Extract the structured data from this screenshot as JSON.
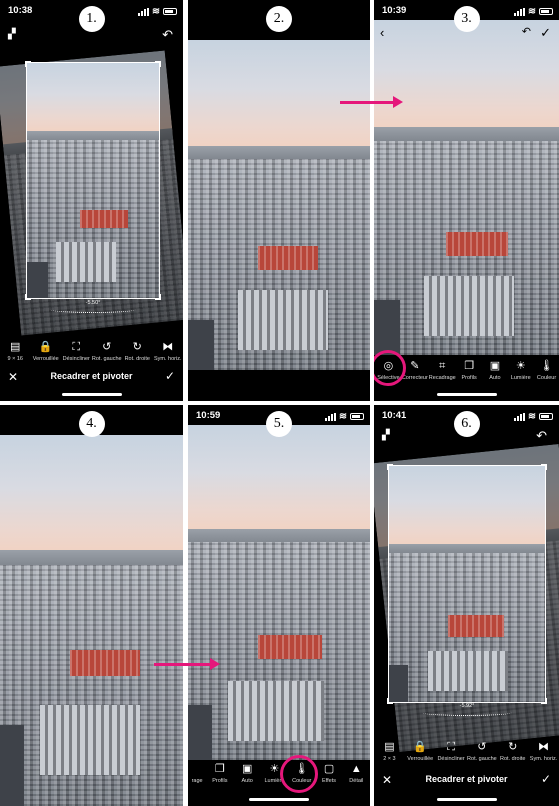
{
  "steps": {
    "s1": "1.",
    "s2": "2.",
    "s3": "3.",
    "s4": "4.",
    "s5": "5.",
    "s6": "6."
  },
  "status": {
    "t1": "10:38",
    "t3": "10:39",
    "t5": "10:59",
    "t6": "10:41"
  },
  "crop_screen_1": {
    "angle": "-5.50°",
    "tools": [
      {
        "icon": "aspect-ratio-icon",
        "label": "9 × 16"
      },
      {
        "icon": "lock-icon",
        "label": "Verrouillée"
      },
      {
        "icon": "straighten-icon",
        "label": "Désincliner"
      },
      {
        "icon": "rotate-left-icon",
        "label": "Rot. gauche"
      },
      {
        "icon": "rotate-right-icon",
        "label": "Rot. droite"
      },
      {
        "icon": "flip-horizontal-icon",
        "label": "Sym. horiz."
      }
    ],
    "footer_title": "Recadrer et pivoter"
  },
  "edit_screen_3": {
    "tools": [
      {
        "icon": "selective-icon",
        "label": "Sélective"
      },
      {
        "icon": "healing-brush-icon",
        "label": "Correcteur"
      },
      {
        "icon": "crop-icon",
        "label": "Recadrage"
      },
      {
        "icon": "profiles-icon",
        "label": "Profils"
      },
      {
        "icon": "auto-icon",
        "label": "Auto"
      },
      {
        "icon": "light-icon",
        "label": "Lumière"
      },
      {
        "icon": "color-icon",
        "label": "Couleur"
      }
    ]
  },
  "edit_screen_5": {
    "tools": [
      {
        "icon": "crop-icon",
        "label": "rage"
      },
      {
        "icon": "profiles-icon",
        "label": "Profils"
      },
      {
        "icon": "auto-icon",
        "label": "Auto"
      },
      {
        "icon": "light-icon",
        "label": "Lumière"
      },
      {
        "icon": "color-icon",
        "label": "Couleur"
      },
      {
        "icon": "effects-icon",
        "label": "Effets"
      },
      {
        "icon": "detail-icon",
        "label": "Détail"
      }
    ]
  },
  "crop_screen_6": {
    "angle": "-5.92°",
    "tools": [
      {
        "icon": "aspect-ratio-icon",
        "label": "2 × 3"
      },
      {
        "icon": "lock-icon",
        "label": "Verrouillée"
      },
      {
        "icon": "straighten-icon",
        "label": "Désincliner"
      },
      {
        "icon": "rotate-left-icon",
        "label": "Rot. gauche"
      },
      {
        "icon": "rotate-right-icon",
        "label": "Rot. droite"
      },
      {
        "icon": "flip-horizontal-icon",
        "label": "Sym. horiz."
      }
    ],
    "footer_title": "Recadrer et pivoter"
  },
  "colors": {
    "highlight": "#e5177b",
    "toolbar_bg": "#000000"
  }
}
